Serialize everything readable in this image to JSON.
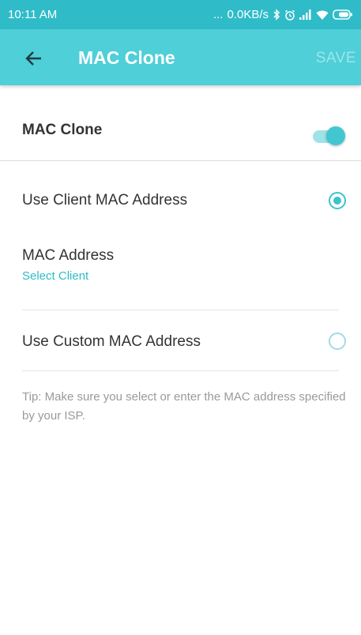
{
  "status_bar": {
    "time": "10:11 AM",
    "dots": "...",
    "speed": "0.0KB/s",
    "icons": [
      "bluetooth-icon",
      "alarm-icon",
      "signal-icon",
      "wifi-icon",
      "battery-icon"
    ]
  },
  "app_bar": {
    "title": "MAC Clone",
    "save_label": "SAVE",
    "back_icon": "arrow-left-icon"
  },
  "settings": {
    "mac_clone_label": "MAC Clone",
    "mac_clone_enabled": true,
    "use_client_label": "Use Client MAC Address",
    "use_client_selected": true,
    "mac_address_label": "MAC Address",
    "select_client_label": "Select Client",
    "use_custom_label": "Use Custom MAC Address",
    "use_custom_selected": false,
    "tip": "Tip: Make sure you select or enter the MAC address specified by your ISP."
  },
  "colors": {
    "status_bar": "#2fbcc8",
    "app_bar": "#4fcfd8",
    "accent": "#3cc3cd",
    "text": "#333333",
    "muted": "#9a9a9a"
  }
}
